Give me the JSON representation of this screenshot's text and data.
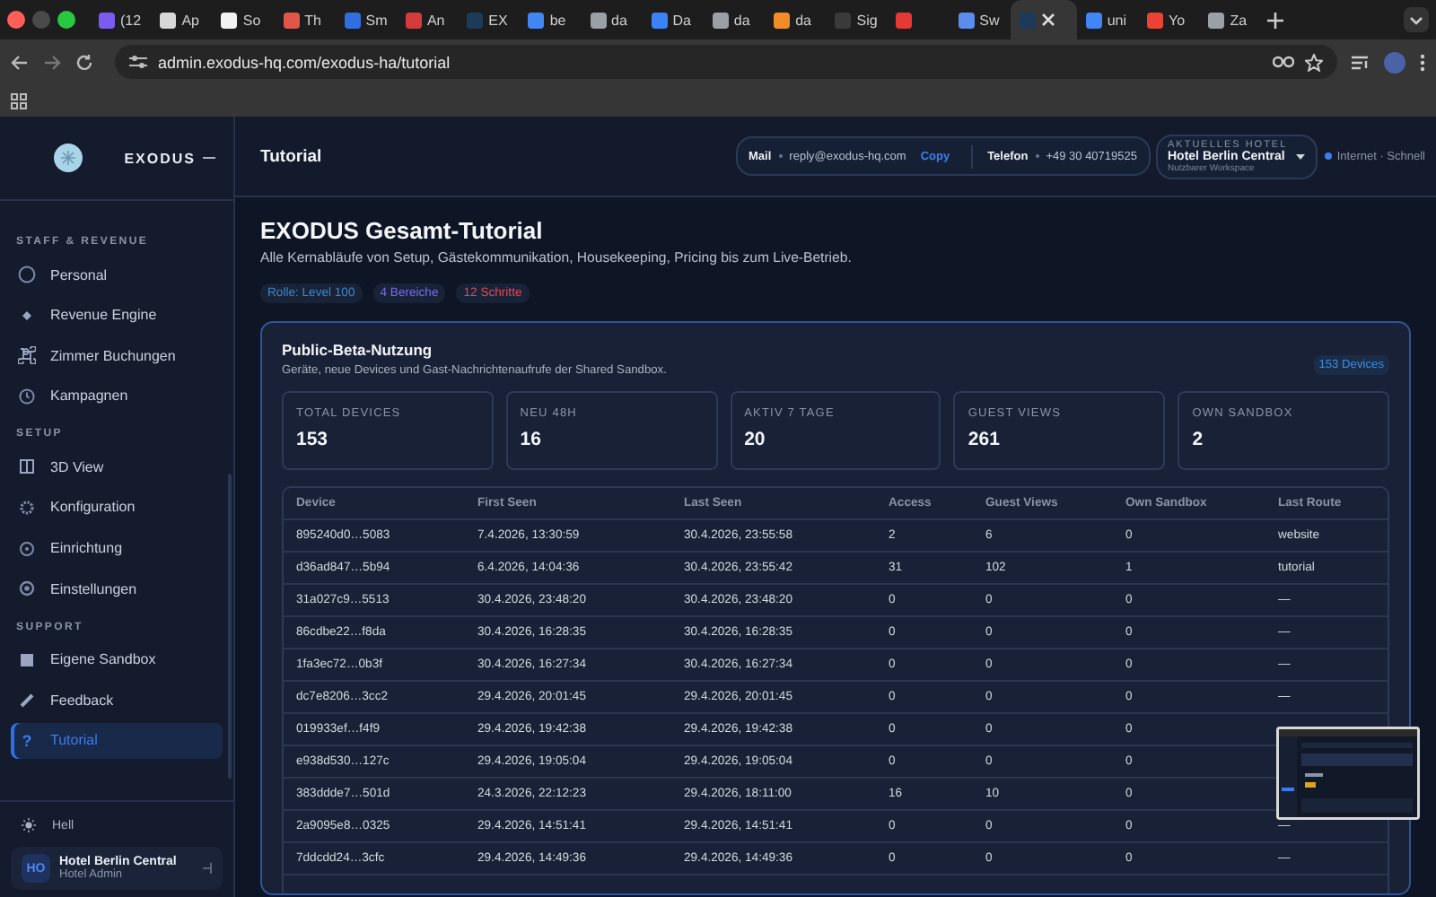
{
  "browser": {
    "tabs": [
      {
        "label": "(12",
        "color": "#7b5cf0",
        "selected": false
      },
      {
        "label": "Ap",
        "color": "#d8d8d8",
        "selected": false
      },
      {
        "label": "So",
        "color": "#f2f2f2",
        "selected": false
      },
      {
        "label": "Th",
        "color": "#e0574a",
        "selected": false
      },
      {
        "label": "Sm",
        "color": "#2f6fe0",
        "selected": false
      },
      {
        "label": "An",
        "color": "#d63b3b",
        "selected": false
      },
      {
        "label": "EX",
        "color": "#1e3a5a",
        "selected": false
      },
      {
        "label": "be",
        "color": "#4285f4",
        "selected": false
      },
      {
        "label": "da",
        "color": "#9aa0a6",
        "selected": false
      },
      {
        "label": "Da",
        "color": "#3b82f6",
        "selected": false
      },
      {
        "label": "da",
        "color": "#9aa0a6",
        "selected": false
      },
      {
        "label": "da",
        "color": "#f28c28",
        "selected": false
      },
      {
        "label": "Sig",
        "color": "#3a3a3a",
        "selected": false
      },
      {
        "color": "#e53935",
        "selected": false
      },
      {
        "label": "Sw",
        "color": "#5b8def",
        "selected": false
      },
      {
        "color": "#1e3a5a",
        "selected": true
      },
      {
        "label": "uni",
        "color": "#4285f4",
        "selected": false
      },
      {
        "label": "Yo",
        "color": "#ea4335",
        "selected": false
      },
      {
        "label": "Za",
        "color": "#9aa0a6",
        "selected": false
      }
    ],
    "address": "admin.exodus-hq.com/exodus-ha/tutorial"
  },
  "sidebar": {
    "brand": "EXODUS",
    "sections": [
      {
        "title": "STAFF & REVENUE",
        "items": [
          {
            "label": "Personal",
            "selected": false
          },
          {
            "label": "Revenue Engine",
            "selected": false
          },
          {
            "label": "Zimmer Buchungen",
            "selected": false
          },
          {
            "label": "Kampagnen",
            "selected": false
          }
        ]
      },
      {
        "title": "SETUP",
        "items": [
          {
            "label": "3D View",
            "selected": false
          },
          {
            "label": "Konfiguration",
            "selected": false
          },
          {
            "label": "Einrichtung",
            "selected": false
          },
          {
            "label": "Einstellungen",
            "selected": false
          }
        ]
      },
      {
        "title": "SUPPORT",
        "items": [
          {
            "label": "Eigene Sandbox",
            "selected": false
          },
          {
            "label": "Feedback",
            "selected": false
          },
          {
            "label": "Tutorial",
            "glyph": "?",
            "selected": true
          }
        ]
      }
    ],
    "theme": "Hell",
    "user": {
      "initials": "HO",
      "name": "Hotel Berlin Central",
      "role": "Hotel Admin"
    }
  },
  "header": {
    "title": "Tutorial",
    "mail_label": "Mail",
    "mail": "reply@exodus-hq.com",
    "copy": "Copy",
    "phone_label": "Telefon",
    "phone": "+49 30 40719525",
    "hotel_label": "AKTUELLES HOTEL",
    "hotel": "Hotel Berlin Central",
    "workspace": "Nutzbarer Workspace",
    "connection": "Internet · Schnell"
  },
  "page": {
    "title": "EXODUS Gesamt-Tutorial",
    "subtitle": "Alle Kernabläufe von Setup, Gästekommunikation, Housekeeping, Pricing bis zum Live-Betrieb.",
    "chips": [
      {
        "label": "Rolle: Level 100",
        "color": "#3f86c8"
      },
      {
        "label": "4 Bereiche",
        "color": "#7a6cf0"
      },
      {
        "label": "12 Schritte",
        "color": "#e0485a"
      }
    ]
  },
  "card": {
    "title": "Public-Beta-Nutzung",
    "subtitle": "Geräte, neue Devices und Gast-Nachrichtenaufrufe der Shared Sandbox.",
    "badge": "153 Devices",
    "stats": [
      {
        "label": "TOTAL DEVICES",
        "value": "153"
      },
      {
        "label": "NEU 48H",
        "value": "16"
      },
      {
        "label": "AKTIV 7 TAGE",
        "value": "20"
      },
      {
        "label": "GUEST VIEWS",
        "value": "261"
      },
      {
        "label": "OWN SANDBOX",
        "value": "2"
      }
    ],
    "table": {
      "columns": [
        "Device",
        "First Seen",
        "Last Seen",
        "Access",
        "Guest Views",
        "Own Sandbox",
        "Last Route"
      ],
      "rows": [
        [
          "895240d0…5083",
          "7.4.2026, 13:30:59",
          "30.4.2026, 23:55:58",
          "2",
          "6",
          "0",
          "website"
        ],
        [
          "d36ad847…5b94",
          "6.4.2026, 14:04:36",
          "30.4.2026, 23:55:42",
          "31",
          "102",
          "1",
          "tutorial"
        ],
        [
          "31a027c9…5513",
          "30.4.2026, 23:48:20",
          "30.4.2026, 23:48:20",
          "0",
          "0",
          "0",
          "—"
        ],
        [
          "86cdbe22…f8da",
          "30.4.2026, 16:28:35",
          "30.4.2026, 16:28:35",
          "0",
          "0",
          "0",
          "—"
        ],
        [
          "1fa3ec72…0b3f",
          "30.4.2026, 16:27:34",
          "30.4.2026, 16:27:34",
          "0",
          "0",
          "0",
          "—"
        ],
        [
          "dc7e8206…3cc2",
          "29.4.2026, 20:01:45",
          "29.4.2026, 20:01:45",
          "0",
          "0",
          "0",
          "—"
        ],
        [
          "019933ef…f4f9",
          "29.4.2026, 19:42:38",
          "29.4.2026, 19:42:38",
          "0",
          "0",
          "0"
        ],
        [
          "e938d530…127c",
          "29.4.2026, 19:05:04",
          "29.4.2026, 19:05:04",
          "0",
          "0",
          "0"
        ],
        [
          "383ddde7…501d",
          "24.3.2026, 22:12:23",
          "29.4.2026, 18:11:00",
          "16",
          "10",
          "0"
        ],
        [
          "2a9095e8…0325",
          "29.4.2026, 14:51:41",
          "29.4.2026, 14:51:41",
          "0",
          "0",
          "0",
          "—"
        ],
        [
          "7ddcdd24…3cfc",
          "29.4.2026, 14:49:36",
          "29.4.2026, 14:49:36",
          "0",
          "0",
          "0",
          "—"
        ]
      ]
    }
  }
}
